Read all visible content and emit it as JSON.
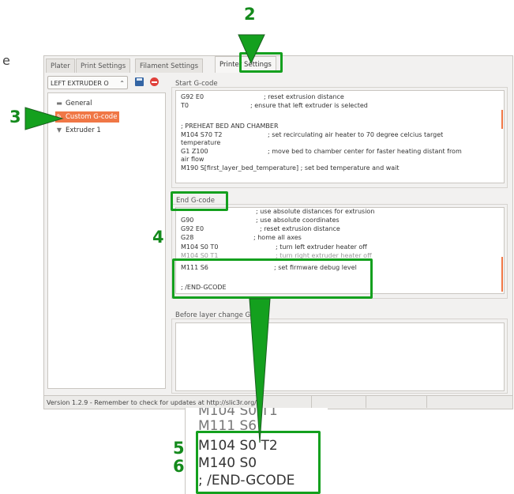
{
  "cut_letter": "e",
  "tabs": [
    {
      "label": "Plater"
    },
    {
      "label": "Print Settings"
    },
    {
      "label": "Filament Settings"
    },
    {
      "label": "Printer Settings"
    }
  ],
  "preset": {
    "selected": "LEFT EXTRUDER O",
    "arrow": "⌃"
  },
  "tree": [
    {
      "label": "General",
      "icon": "printer-icon"
    },
    {
      "label": "Custom G-code",
      "icon": "wrench-icon"
    },
    {
      "label": "Extruder 1",
      "icon": "funnel-icon"
    }
  ],
  "start_gcode": {
    "label": "Start G-code",
    "lines": [
      {
        "code": "G92 E0",
        "comment": "; reset extrusion distance"
      },
      {
        "code": "T0",
        "comment": "; ensure that left extruder is selected"
      },
      {
        "code": "",
        "comment": ""
      },
      {
        "code": "; PREHEAT BED AND CHAMBER",
        "comment": ""
      },
      {
        "code": "M104 S70 T2",
        "comment": "; set recirculating air heater to 70 degree celcius target"
      },
      {
        "code": "temperature",
        "comment": ""
      },
      {
        "code": "G1 Z100",
        "comment": "; move bed to chamber center for faster heating distant from"
      },
      {
        "code": "air flow",
        "comment": ""
      },
      {
        "code": "M190 S[first_layer_bed_temperature] ; set bed temperature and wait",
        "comment": ""
      }
    ]
  },
  "end_gcode": {
    "label": "End G-code",
    "lines": [
      {
        "code": "",
        "comment": "; use absolute distances for extrusion"
      },
      {
        "code": "G90",
        "comment": "; use absolute coordinates"
      },
      {
        "code": "G92 E0",
        "comment": "; reset extrusion distance"
      },
      {
        "code": "G28",
        "comment": "; home all axes"
      },
      {
        "code": "M104 S0 T0",
        "comment": "; turn left extruder heater off"
      },
      {
        "code": "M104 S0 T1",
        "comment": "; turn right extruder heater off"
      },
      {
        "code": "M111 S6",
        "comment": "; set firmware debug level"
      },
      {
        "code": "",
        "comment": ""
      },
      {
        "code": "; /END-GCODE",
        "comment": ""
      }
    ]
  },
  "before_layer_change": {
    "label": "Before layer change G-code"
  },
  "status_bar": {
    "text": "Version 1.2.9 - Remember to check for updates at http://slic3r.org/"
  },
  "annotations": {
    "n2": "2",
    "n3": "3",
    "n4": "4",
    "n5": "5",
    "n6": "6"
  },
  "zoom_inset": {
    "lines": [
      "M104 S0 T1",
      "M111 S6",
      "M104 S0 T2",
      "M140 S0",
      "; /END-GCODE"
    ]
  },
  "colors": {
    "selection": "#f07746",
    "annotation_green": "#14a01e"
  }
}
